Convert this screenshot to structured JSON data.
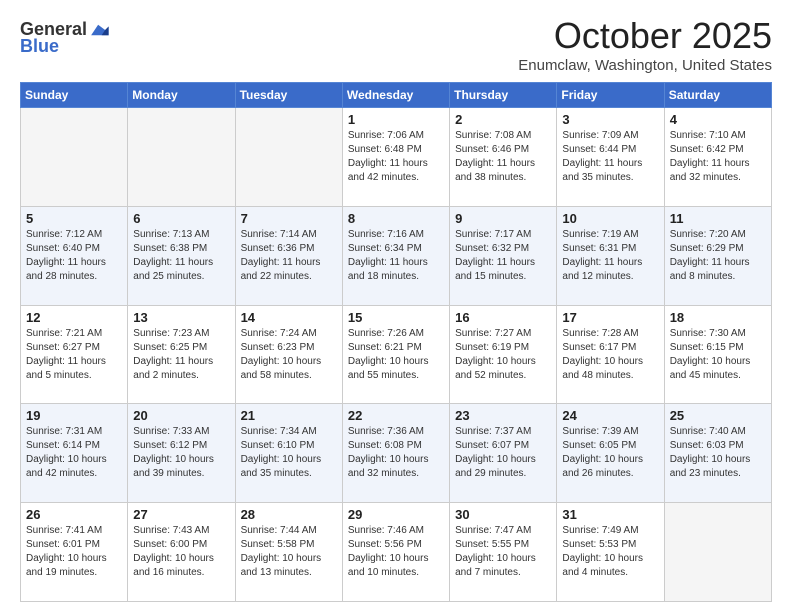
{
  "header": {
    "logo_general": "General",
    "logo_blue": "Blue",
    "month": "October 2025",
    "location": "Enumclaw, Washington, United States"
  },
  "weekdays": [
    "Sunday",
    "Monday",
    "Tuesday",
    "Wednesday",
    "Thursday",
    "Friday",
    "Saturday"
  ],
  "weeks": [
    [
      {
        "day": "",
        "info": ""
      },
      {
        "day": "",
        "info": ""
      },
      {
        "day": "",
        "info": ""
      },
      {
        "day": "1",
        "info": "Sunrise: 7:06 AM\nSunset: 6:48 PM\nDaylight: 11 hours\nand 42 minutes."
      },
      {
        "day": "2",
        "info": "Sunrise: 7:08 AM\nSunset: 6:46 PM\nDaylight: 11 hours\nand 38 minutes."
      },
      {
        "day": "3",
        "info": "Sunrise: 7:09 AM\nSunset: 6:44 PM\nDaylight: 11 hours\nand 35 minutes."
      },
      {
        "day": "4",
        "info": "Sunrise: 7:10 AM\nSunset: 6:42 PM\nDaylight: 11 hours\nand 32 minutes."
      }
    ],
    [
      {
        "day": "5",
        "info": "Sunrise: 7:12 AM\nSunset: 6:40 PM\nDaylight: 11 hours\nand 28 minutes."
      },
      {
        "day": "6",
        "info": "Sunrise: 7:13 AM\nSunset: 6:38 PM\nDaylight: 11 hours\nand 25 minutes."
      },
      {
        "day": "7",
        "info": "Sunrise: 7:14 AM\nSunset: 6:36 PM\nDaylight: 11 hours\nand 22 minutes."
      },
      {
        "day": "8",
        "info": "Sunrise: 7:16 AM\nSunset: 6:34 PM\nDaylight: 11 hours\nand 18 minutes."
      },
      {
        "day": "9",
        "info": "Sunrise: 7:17 AM\nSunset: 6:32 PM\nDaylight: 11 hours\nand 15 minutes."
      },
      {
        "day": "10",
        "info": "Sunrise: 7:19 AM\nSunset: 6:31 PM\nDaylight: 11 hours\nand 12 minutes."
      },
      {
        "day": "11",
        "info": "Sunrise: 7:20 AM\nSunset: 6:29 PM\nDaylight: 11 hours\nand 8 minutes."
      }
    ],
    [
      {
        "day": "12",
        "info": "Sunrise: 7:21 AM\nSunset: 6:27 PM\nDaylight: 11 hours\nand 5 minutes."
      },
      {
        "day": "13",
        "info": "Sunrise: 7:23 AM\nSunset: 6:25 PM\nDaylight: 11 hours\nand 2 minutes."
      },
      {
        "day": "14",
        "info": "Sunrise: 7:24 AM\nSunset: 6:23 PM\nDaylight: 10 hours\nand 58 minutes."
      },
      {
        "day": "15",
        "info": "Sunrise: 7:26 AM\nSunset: 6:21 PM\nDaylight: 10 hours\nand 55 minutes."
      },
      {
        "day": "16",
        "info": "Sunrise: 7:27 AM\nSunset: 6:19 PM\nDaylight: 10 hours\nand 52 minutes."
      },
      {
        "day": "17",
        "info": "Sunrise: 7:28 AM\nSunset: 6:17 PM\nDaylight: 10 hours\nand 48 minutes."
      },
      {
        "day": "18",
        "info": "Sunrise: 7:30 AM\nSunset: 6:15 PM\nDaylight: 10 hours\nand 45 minutes."
      }
    ],
    [
      {
        "day": "19",
        "info": "Sunrise: 7:31 AM\nSunset: 6:14 PM\nDaylight: 10 hours\nand 42 minutes."
      },
      {
        "day": "20",
        "info": "Sunrise: 7:33 AM\nSunset: 6:12 PM\nDaylight: 10 hours\nand 39 minutes."
      },
      {
        "day": "21",
        "info": "Sunrise: 7:34 AM\nSunset: 6:10 PM\nDaylight: 10 hours\nand 35 minutes."
      },
      {
        "day": "22",
        "info": "Sunrise: 7:36 AM\nSunset: 6:08 PM\nDaylight: 10 hours\nand 32 minutes."
      },
      {
        "day": "23",
        "info": "Sunrise: 7:37 AM\nSunset: 6:07 PM\nDaylight: 10 hours\nand 29 minutes."
      },
      {
        "day": "24",
        "info": "Sunrise: 7:39 AM\nSunset: 6:05 PM\nDaylight: 10 hours\nand 26 minutes."
      },
      {
        "day": "25",
        "info": "Sunrise: 7:40 AM\nSunset: 6:03 PM\nDaylight: 10 hours\nand 23 minutes."
      }
    ],
    [
      {
        "day": "26",
        "info": "Sunrise: 7:41 AM\nSunset: 6:01 PM\nDaylight: 10 hours\nand 19 minutes."
      },
      {
        "day": "27",
        "info": "Sunrise: 7:43 AM\nSunset: 6:00 PM\nDaylight: 10 hours\nand 16 minutes."
      },
      {
        "day": "28",
        "info": "Sunrise: 7:44 AM\nSunset: 5:58 PM\nDaylight: 10 hours\nand 13 minutes."
      },
      {
        "day": "29",
        "info": "Sunrise: 7:46 AM\nSunset: 5:56 PM\nDaylight: 10 hours\nand 10 minutes."
      },
      {
        "day": "30",
        "info": "Sunrise: 7:47 AM\nSunset: 5:55 PM\nDaylight: 10 hours\nand 7 minutes."
      },
      {
        "day": "31",
        "info": "Sunrise: 7:49 AM\nSunset: 5:53 PM\nDaylight: 10 hours\nand 4 minutes."
      },
      {
        "day": "",
        "info": ""
      }
    ]
  ]
}
